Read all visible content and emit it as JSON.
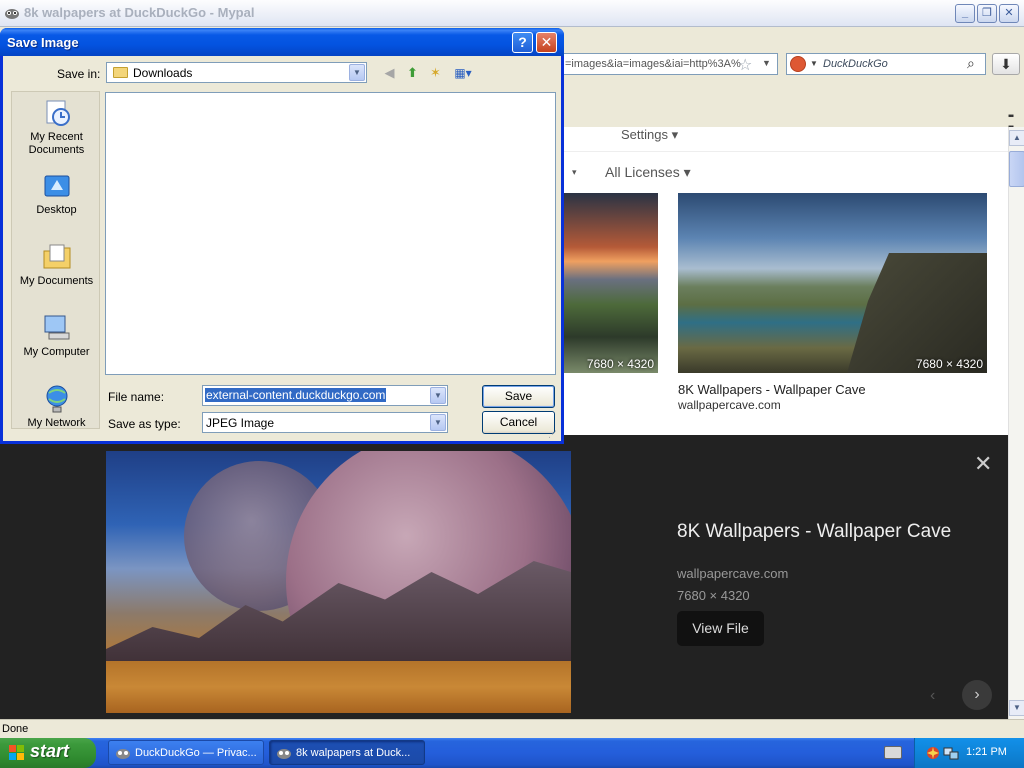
{
  "browser": {
    "title": "8k walpapers at DuckDuckGo - Mypal",
    "url_tail": "=images&ia=images&iai=http%3A%",
    "search_placeholder": "DuckDuckGo"
  },
  "page": {
    "settings_label": "Settings ▾",
    "license_filter": "All Licenses ▾",
    "filter_caret": "▾",
    "thumbnails": [
      {
        "size": "7680 × 4320"
      },
      {
        "size": "7680 × 4320"
      }
    ],
    "result": {
      "title": "8K Wallpapers - Wallpaper Cave",
      "source": "wallpapercave.com"
    },
    "detail": {
      "title": "8K Wallpapers - Wallpaper Cave",
      "source": "wallpapercave.com",
      "size": "7680 × 4320",
      "view_file_label": "View File"
    }
  },
  "statusbar": {
    "text": "Done"
  },
  "dialog": {
    "title": "Save Image",
    "save_in_label": "Save in:",
    "save_in_value": "Downloads",
    "places": [
      {
        "label": "My Recent Documents"
      },
      {
        "label": "Desktop"
      },
      {
        "label": "My Documents"
      },
      {
        "label": "My Computer"
      },
      {
        "label": "My Network"
      }
    ],
    "file_name_label": "File name:",
    "file_name_value": "external-content.duckduckgo.com",
    "save_as_type_label": "Save as type:",
    "save_as_type_value": "JPEG Image",
    "save_label": "Save",
    "cancel_label": "Cancel",
    "help_label": "?",
    "close_label": "✕"
  },
  "taskbar": {
    "start_label": "start",
    "tasks": [
      {
        "label": "DuckDuckGo — Privac..."
      },
      {
        "label": "8k walpapers at Duck..."
      }
    ],
    "clock": "1:21 PM"
  },
  "colors": {
    "xp_blue": "#0453e0",
    "start_green": "#3c9a3c",
    "selection": "#316ac5",
    "detail_bg": "#222222"
  }
}
